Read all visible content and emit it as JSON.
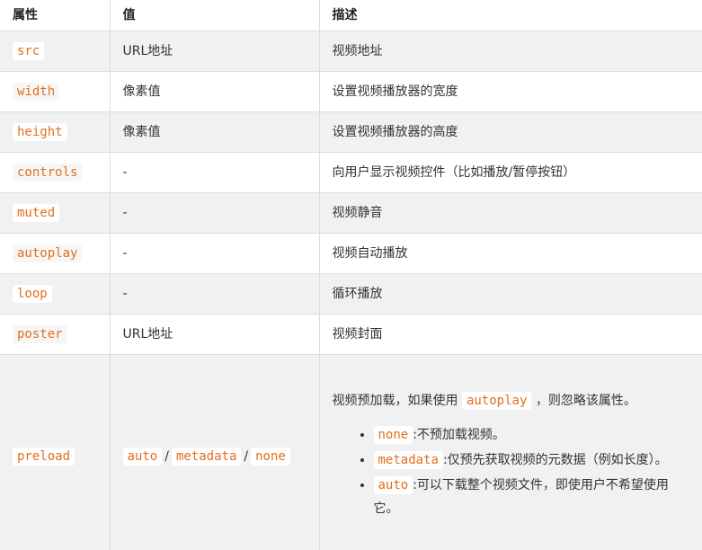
{
  "headers": {
    "attr": "属性",
    "value": "值",
    "desc": "描述"
  },
  "rows": [
    {
      "attr": "src",
      "value": "URL地址",
      "desc": "视频地址"
    },
    {
      "attr": "width",
      "value": "像素值",
      "desc": "设置视频播放器的宽度"
    },
    {
      "attr": "height",
      "value": "像素值",
      "desc": "设置视频播放器的高度"
    },
    {
      "attr": "controls",
      "value": "-",
      "desc": "向用户显示视频控件（比如播放/暂停按钮）"
    },
    {
      "attr": "muted",
      "value": "-",
      "desc": "视频静音"
    },
    {
      "attr": "autoplay",
      "value": "-",
      "desc": "视频自动播放"
    },
    {
      "attr": "loop",
      "value": "-",
      "desc": "循环播放"
    },
    {
      "attr": "poster",
      "value": "URL地址",
      "desc": "视频封面"
    }
  ],
  "preload": {
    "attr": "preload",
    "values": [
      "auto",
      "metadata",
      "none"
    ],
    "value_sep": "/",
    "desc_before": "视频预加载，如果使用",
    "desc_code": "autoplay",
    "desc_after": "，则忽略该属性。",
    "items": [
      {
        "code": "none",
        "text": ":不预加载视频。"
      },
      {
        "code": "metadata",
        "text": ":仅预先获取视频的元数据（例如长度）。"
      },
      {
        "code": "auto",
        "text": ":可以下载整个视频文件，即使用户不希望使用它。"
      }
    ]
  }
}
